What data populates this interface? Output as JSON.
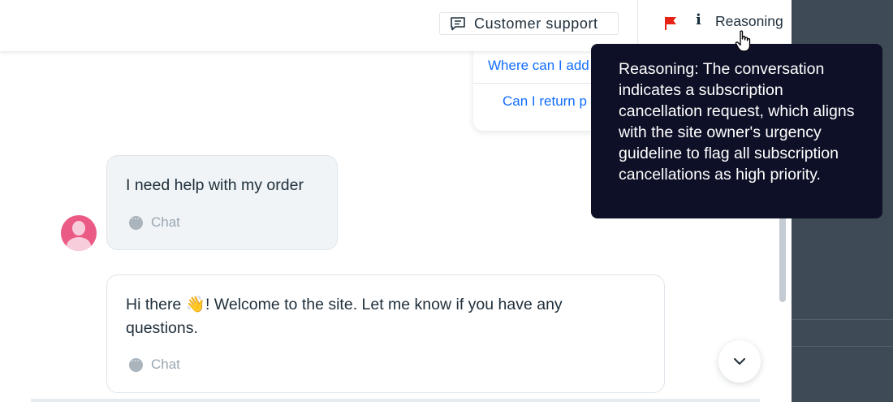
{
  "header": {
    "channel_chip": "Customer support",
    "reasoning_label": "Reasoning"
  },
  "tooltip": {
    "text": "Reasoning: The conversation indicates a subscription cancellation request, which aligns with the site owner's urgency guideline to flag all subscription cancellations as high priority."
  },
  "suggestions": [
    {
      "label": "Where can I add"
    },
    {
      "label": "Can I return p"
    }
  ],
  "messages": [
    {
      "text": "I need help with my order",
      "channel": "Chat"
    },
    {
      "text": "Hi there 👋! Welcome to the site. Let me know if you have any questions.",
      "channel": "Chat"
    }
  ],
  "colors": {
    "flag": "#e62214",
    "accent": "#116dff",
    "tooltip_bg": "#0e1027",
    "avatar": "#ea5a85"
  },
  "icons": [
    "message-square-icon",
    "flag-icon",
    "info-icon",
    "hand-pointer-icon",
    "chat-bubble-icon",
    "chevron-down-icon"
  ]
}
